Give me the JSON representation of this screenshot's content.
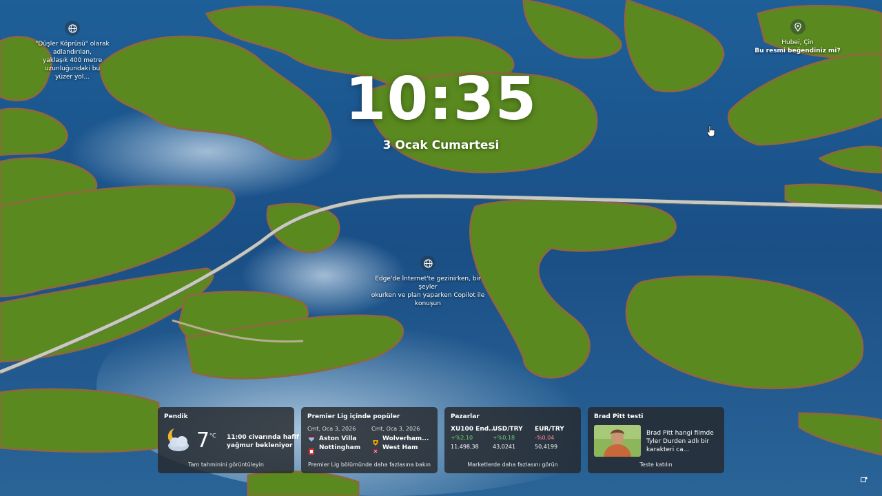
{
  "lock_screen": {
    "time": "10:35",
    "date": "3 Ocak Cumartesi"
  },
  "spotlight": {
    "left_hint": {
      "icon": "globe-icon",
      "line1": "\"Düşler Köprüsü\" olarak adlandırılan,",
      "line2": "yaklaşık 400 metre uzunluğundaki bu",
      "line3": "yüzer yol..."
    },
    "right_hint": {
      "icon": "location-pin-icon",
      "line1": "Hubei, Çin",
      "line2": "Bu resmi beğendiniz mi?"
    },
    "center_hint": {
      "icon": "globe-icon",
      "line1": "Edge'de İnternet'te gezinirken, bir şeyler",
      "line2": "okurken ve plan yaparken Copilot ile",
      "line3": "konuşun"
    }
  },
  "widgets": {
    "weather": {
      "title": "Pendik",
      "temp": "7",
      "unit": "°C",
      "desc1": "11:00 civarında hafif",
      "desc2": "yağmur bekleniyor",
      "footer": "Tam tahminini görüntüleyin",
      "icon": "partly-cloudy-night-icon"
    },
    "football": {
      "title": "Premier Lig içinde popüler",
      "match1": {
        "date": "Cmt, Oca 3, 2026",
        "home": "Aston Villa",
        "away": "Nottingham"
      },
      "match2": {
        "date": "Cmt, Oca 3, 2026",
        "home": "Wolverham...",
        "away": "West Ham"
      },
      "footer": "Premier Lig bölümünde daha fazlasına bakın"
    },
    "markets": {
      "title": "Pazarlar",
      "items": [
        {
          "name": "XU100 End...",
          "change": "+%2,10",
          "value": "11.498,38",
          "color": "#6fd36f"
        },
        {
          "name": "USD/TRY",
          "change": "+%0,18",
          "value": "43,0241",
          "color": "#6fd36f"
        },
        {
          "name": "EUR/TRY",
          "change": "-%0,04",
          "value": "50,4199",
          "color": "#ff8a8a"
        }
      ],
      "footer": "Marketlerde daha fazlasını görün"
    },
    "quiz": {
      "title": "Brad Pitt testi",
      "text1": "Brad Pitt hangi filmde",
      "text2": "Tyler Durden adlı bir",
      "text3": "karakteri ca...",
      "footer": "Teste katılın"
    }
  }
}
